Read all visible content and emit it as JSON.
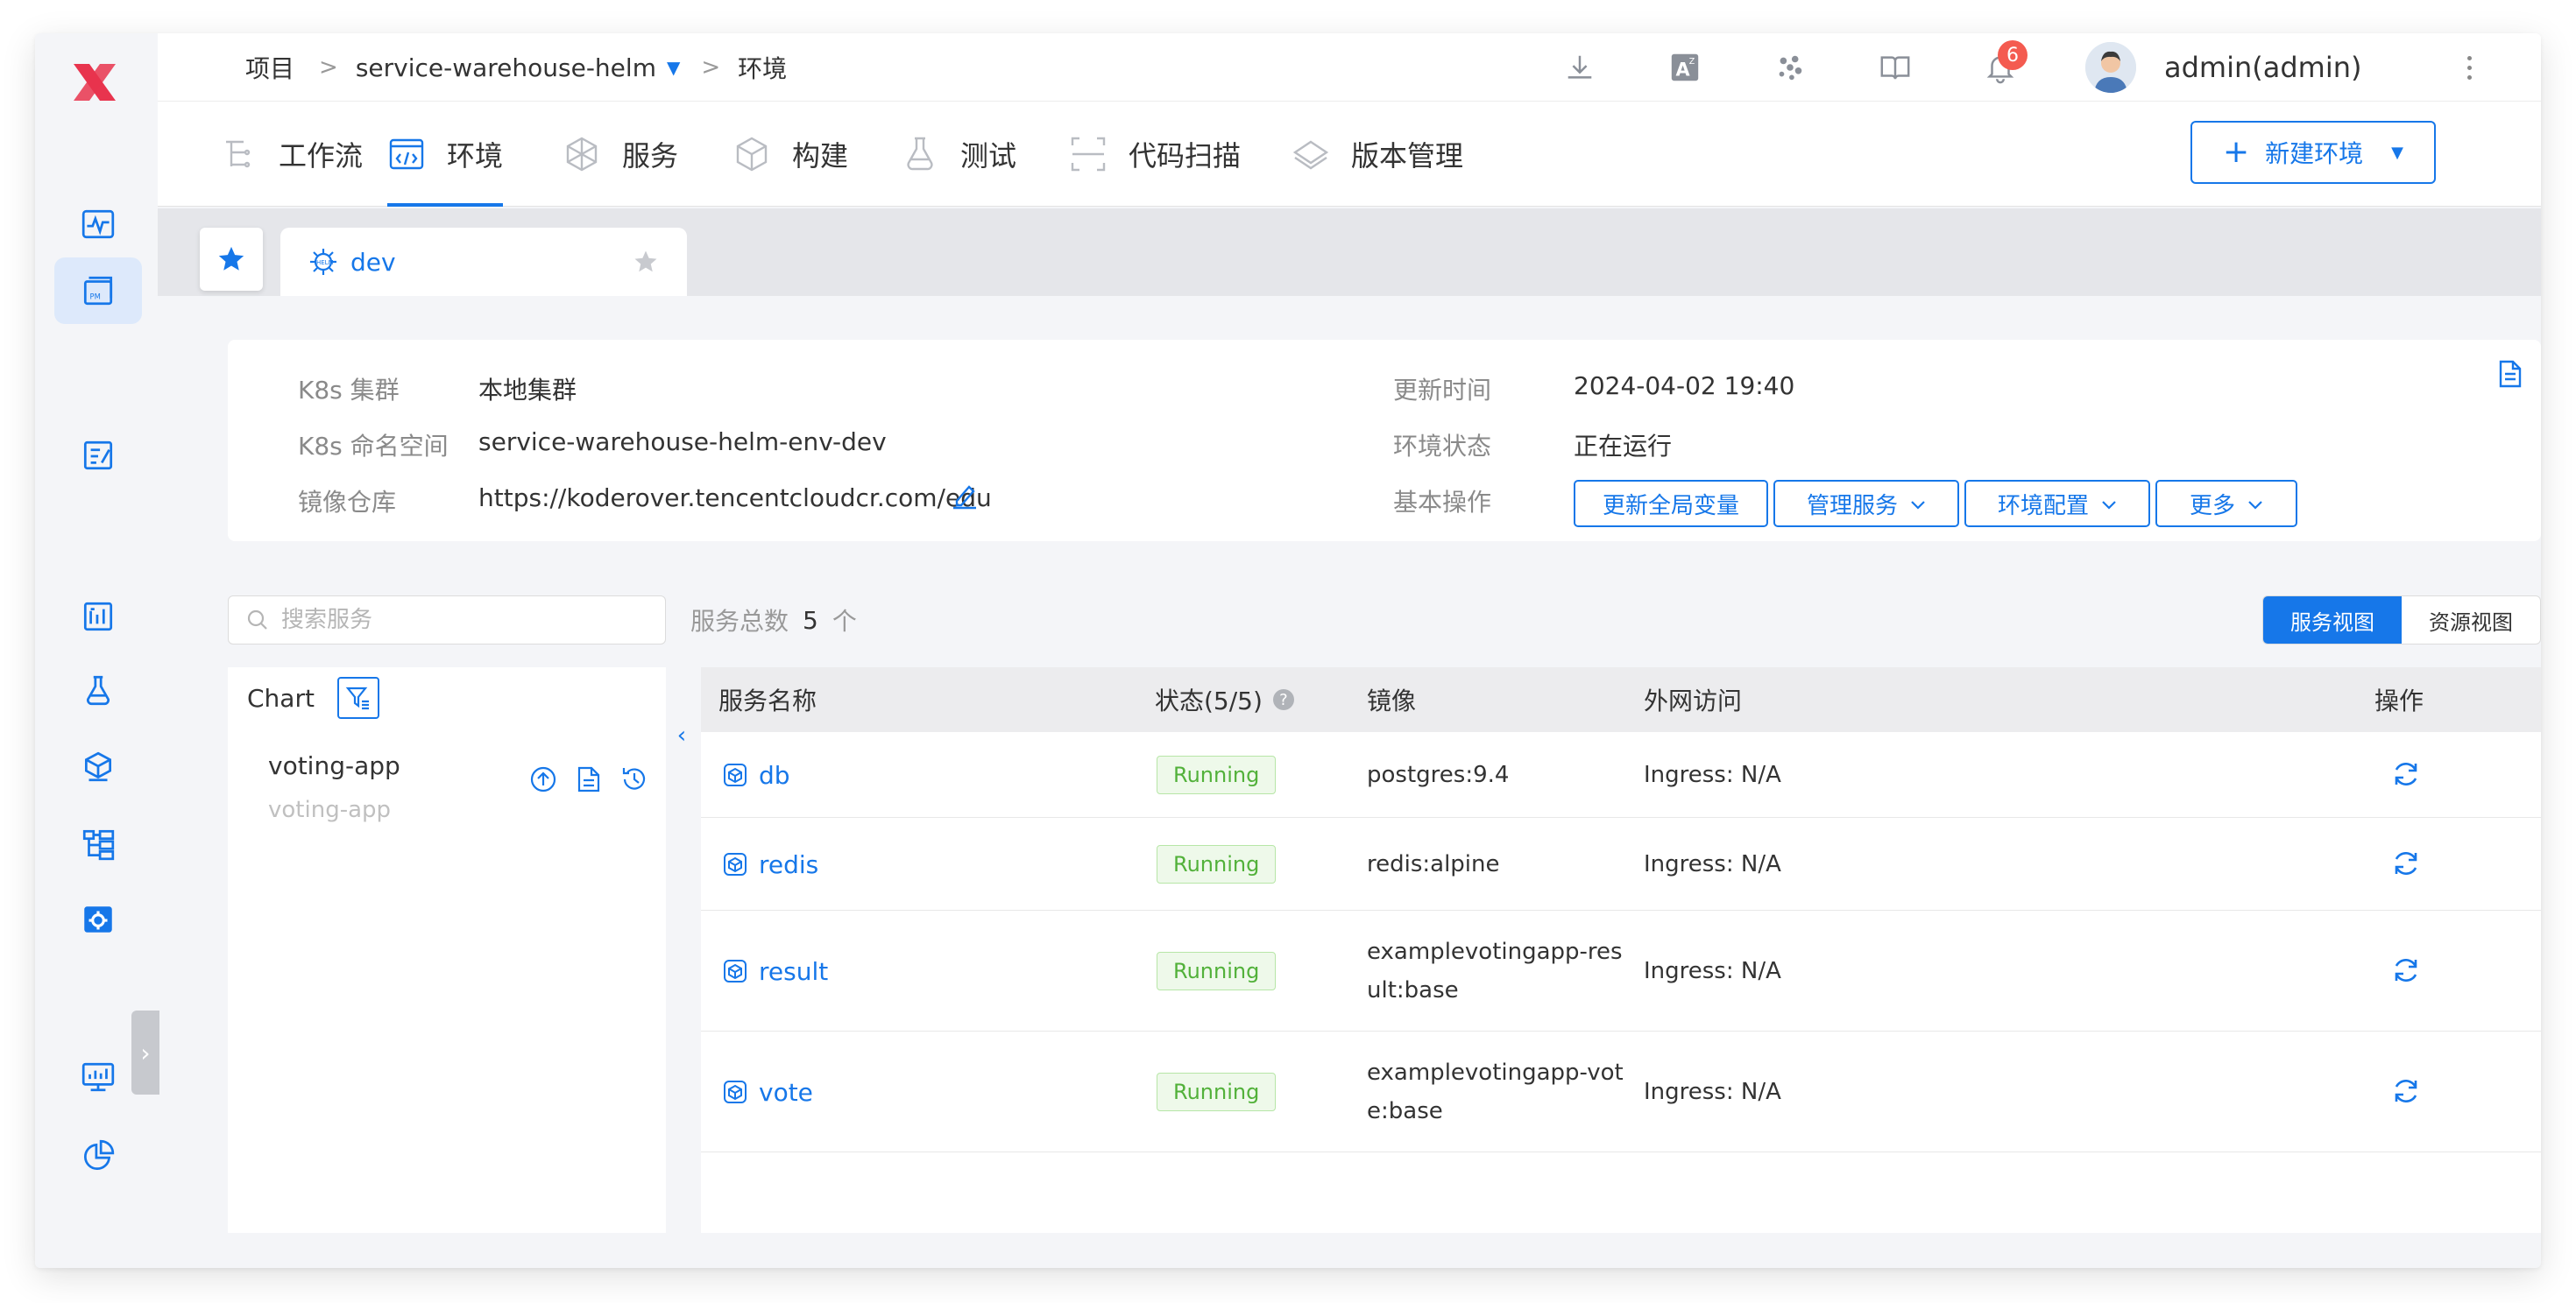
{
  "breadcrumb": {
    "root": "项目",
    "sep": ">",
    "project": "service-warehouse-helm",
    "current": "环境"
  },
  "header": {
    "notification_count": "6",
    "username": "admin(admin)"
  },
  "nav": {
    "items": [
      {
        "label": "工作流",
        "icon": "workflow-icon"
      },
      {
        "label": "环境",
        "icon": "environment-icon"
      },
      {
        "label": "服务",
        "icon": "service-icon"
      },
      {
        "label": "构建",
        "icon": "build-icon"
      },
      {
        "label": "测试",
        "icon": "test-icon"
      },
      {
        "label": "代码扫描",
        "icon": "code-scan-icon"
      },
      {
        "label": "版本管理",
        "icon": "version-icon"
      }
    ],
    "active": "环境",
    "new_env_label": "新建环境"
  },
  "env_tab": {
    "name": "dev"
  },
  "env_info": {
    "cluster_label": "K8s 集群",
    "cluster_value": "本地集群",
    "namespace_label": "K8s 命名空间",
    "namespace_value": "service-warehouse-helm-env-dev",
    "registry_label": "镜像仓库",
    "registry_value": "https://koderover.tencentcloudcr.com/edu",
    "update_time_label": "更新时间",
    "update_time_value": "2024-04-02 19:40",
    "status_label": "环境状态",
    "status_value": "正在运行",
    "ops_label": "基本操作",
    "ops": [
      "更新全局变量",
      "管理服务",
      "环境配置",
      "更多"
    ]
  },
  "services": {
    "search_placeholder": "搜索服务",
    "count_label": "服务总数",
    "count_value": "5",
    "count_unit": "个",
    "view_service": "服务视图",
    "view_resource": "资源视图",
    "chart_title": "Chart",
    "chart_name": "voting-app",
    "chart_sub": "voting-app",
    "columns": {
      "name": "服务名称",
      "status": "状态(5/5)",
      "image": "镜像",
      "access": "外网访问",
      "ops": "操作"
    },
    "rows": [
      {
        "name": "db",
        "status": "Running",
        "image": "postgres:9.4",
        "access": "Ingress: N/A"
      },
      {
        "name": "redis",
        "status": "Running",
        "image": "redis:alpine",
        "access": "Ingress: N/A"
      },
      {
        "name": "result",
        "status": "Running",
        "image_line1": "examplevotingapp-res",
        "image_line2": "ult:base",
        "access": "Ingress: N/A"
      },
      {
        "name": "vote",
        "status": "Running",
        "image_line1": "examplevotingapp-vot",
        "image_line2": "e:base",
        "access": "Ingress: N/A"
      }
    ]
  },
  "colors": {
    "primary": "#1677e9",
    "brand": "#e8344e",
    "running_text": "#52b13a",
    "running_bg": "#eef9ea",
    "badge": "#f45b50"
  }
}
